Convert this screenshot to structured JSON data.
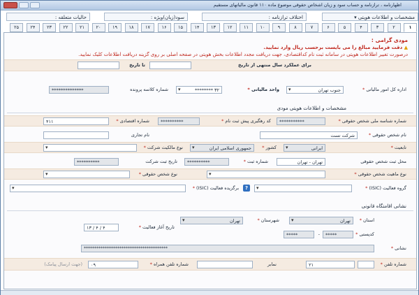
{
  "window": {
    "title": "اظهارنامه ، ترازنامه و حساب سود و زیان اشخاص حقوقی موضوع ماده ۱۱۰ قانون مالیاتهای مستقیم"
  },
  "infobar": {
    "identity": "مشخصات و اطلاعات هویتی",
    "declaration_differences": "اختلاف ترازنامه :",
    "profit_loss": "سود(زیان)ویژه :",
    "special_status": "حالیات متعلقه :"
  },
  "tabs": [
    "۱",
    "۲",
    "۳",
    "۴",
    "۵",
    "۶",
    "۷",
    "۸",
    "۹",
    "۱۰",
    "۱۱",
    "۱۲",
    "۱۳",
    "۱۴",
    "۱۵",
    "۱۶",
    "۱۷",
    "۱۸",
    "۱۹",
    "۲۰",
    "۲۱",
    "۲۲",
    "۲۳",
    "۲۴",
    "۲۵"
  ],
  "notice": {
    "greeting": "مودی گرامی :",
    "line1": "دقت فرمایید مبالغ را می بایست برحسب ریال وارد نمایید.",
    "line2": "درصورت تغییر اطلاعات هویتی در سامانه ثبت نام کداقتصادی، جهت دریافت مجدد اطلاعات بخش هویتی در صفحه اصلی بر روی گزینه دریافت اطلاعات کلیک نمایید."
  },
  "period": {
    "label": "برای عملکرد سال منتهی از تاریخ",
    "to_label": "تا تاریخ",
    "from_value": "",
    "to_value": ""
  },
  "tax_office": {
    "general_dept_label": "اداره کل امور مالیاتی",
    "general_dept_value": "جنوب تهران",
    "unit_label": "واحد مالیاتی",
    "unit_value": "۳۲ ********",
    "file_class_label": "شماره کلاسه پرونده",
    "file_class_value": "**************"
  },
  "identity_section": {
    "title": "مشخصات و اطلاعات هویتی مودی",
    "national_id_label": "شماره شناسه ملی شخص حقوقی",
    "national_id_value": "***********",
    "tracking_code_label": "کد رهگیری پیش ثبت نام",
    "tracking_code_value": "**********",
    "economic_code_label": "شماره اقتصادی",
    "economic_code_value": "۴۱۱",
    "legal_name_label": "نام شخص حقوقی",
    "legal_name_value": "شرکت تست",
    "trade_name_label": "نام تجاری",
    "trade_name_value": "",
    "nationality_label": "تابعیت",
    "nationality_value": "ایرانی",
    "country_label": "کشور",
    "country_value": "جمهوری اسلامی ایران",
    "ownership_type_label": "نوع مالکیت شرکت",
    "ownership_type_value": "",
    "registration_place_label": "محل ثبت شخص حقوقی",
    "registration_place_value": "تهران - تهران",
    "registration_no_label": "شماره ثبت",
    "registration_no_value": "**********",
    "registration_date_label": "تاریخ ثبت شرکت",
    "registration_date_value": "**********",
    "legal_entity_nature_label": "نوع ماهیت شخص حقوقی",
    "legal_entity_nature_value": "",
    "legal_entity_type_label": "نوع شخص حقوقی",
    "legal_entity_type_value": "",
    "activity_group_label": "گروه فعالیت (ISIC)",
    "activity_group_value": "",
    "main_activity_label": "برگزیده فعالیت (ISIC)",
    "main_activity_value": "",
    "help_glyph": "?"
  },
  "address_section": {
    "title": "نشانی اقامتگاه قانونی",
    "start_date_label": "تاریخ آغاز فعالیت",
    "start_date_value": "۱۳ / ۴ / ۴",
    "province_label": "استان",
    "province_value": "تهران",
    "city_label": "شهرستان",
    "city_value": "تهران",
    "postal_code_label": "کدپستی",
    "postal_code_value_1": "*****",
    "postal_code_value_2": "*****",
    "address_label": "نشانی",
    "address_value": "****************************************",
    "phone_label": "شماره تلفن",
    "phone_code": "۲۱",
    "fax_label": "نمابر",
    "mobile_label": "شماره تلفن همراه",
    "mobile_value": "۰۹",
    "mobile_hint": "(جهت ارسال پیامک)"
  }
}
